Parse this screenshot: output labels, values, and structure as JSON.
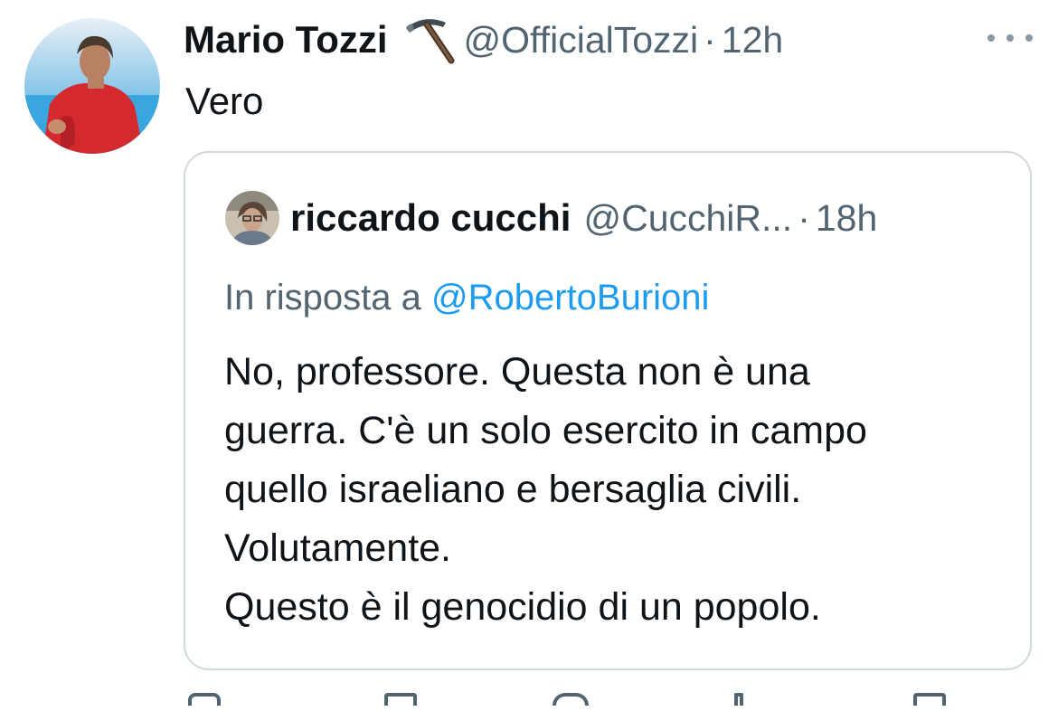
{
  "tweet": {
    "author": {
      "display_name": "Mario Tozzi",
      "emoji_icon": "pick-icon",
      "handle": "@OfficialTozzi",
      "separator": "·",
      "time": "12h"
    },
    "text": "Vero",
    "more_icon": "more-icon"
  },
  "quoted_tweet": {
    "author": {
      "display_name": "riccardo cucchi",
      "handle": "@CucchiR...",
      "separator": "·",
      "time": "18h"
    },
    "reply_prefix": "In risposta a",
    "reply_to": "@RobertoBurioni",
    "text_lines": [
      "No, professore. Questa non è una",
      "guerra. C'è un solo esercito in campo",
      "quello israeliano e bersaglia civili.",
      "Volutamente.",
      "Questo è il genocidio di un popolo."
    ]
  },
  "colors": {
    "text_primary": "#0f1419",
    "text_secondary": "#536471",
    "link": "#1d9bf0",
    "border": "#cfd9de"
  },
  "action_icons": [
    "reply-icon",
    "retweet-icon",
    "like-icon",
    "views-icon",
    "share-icon"
  ]
}
